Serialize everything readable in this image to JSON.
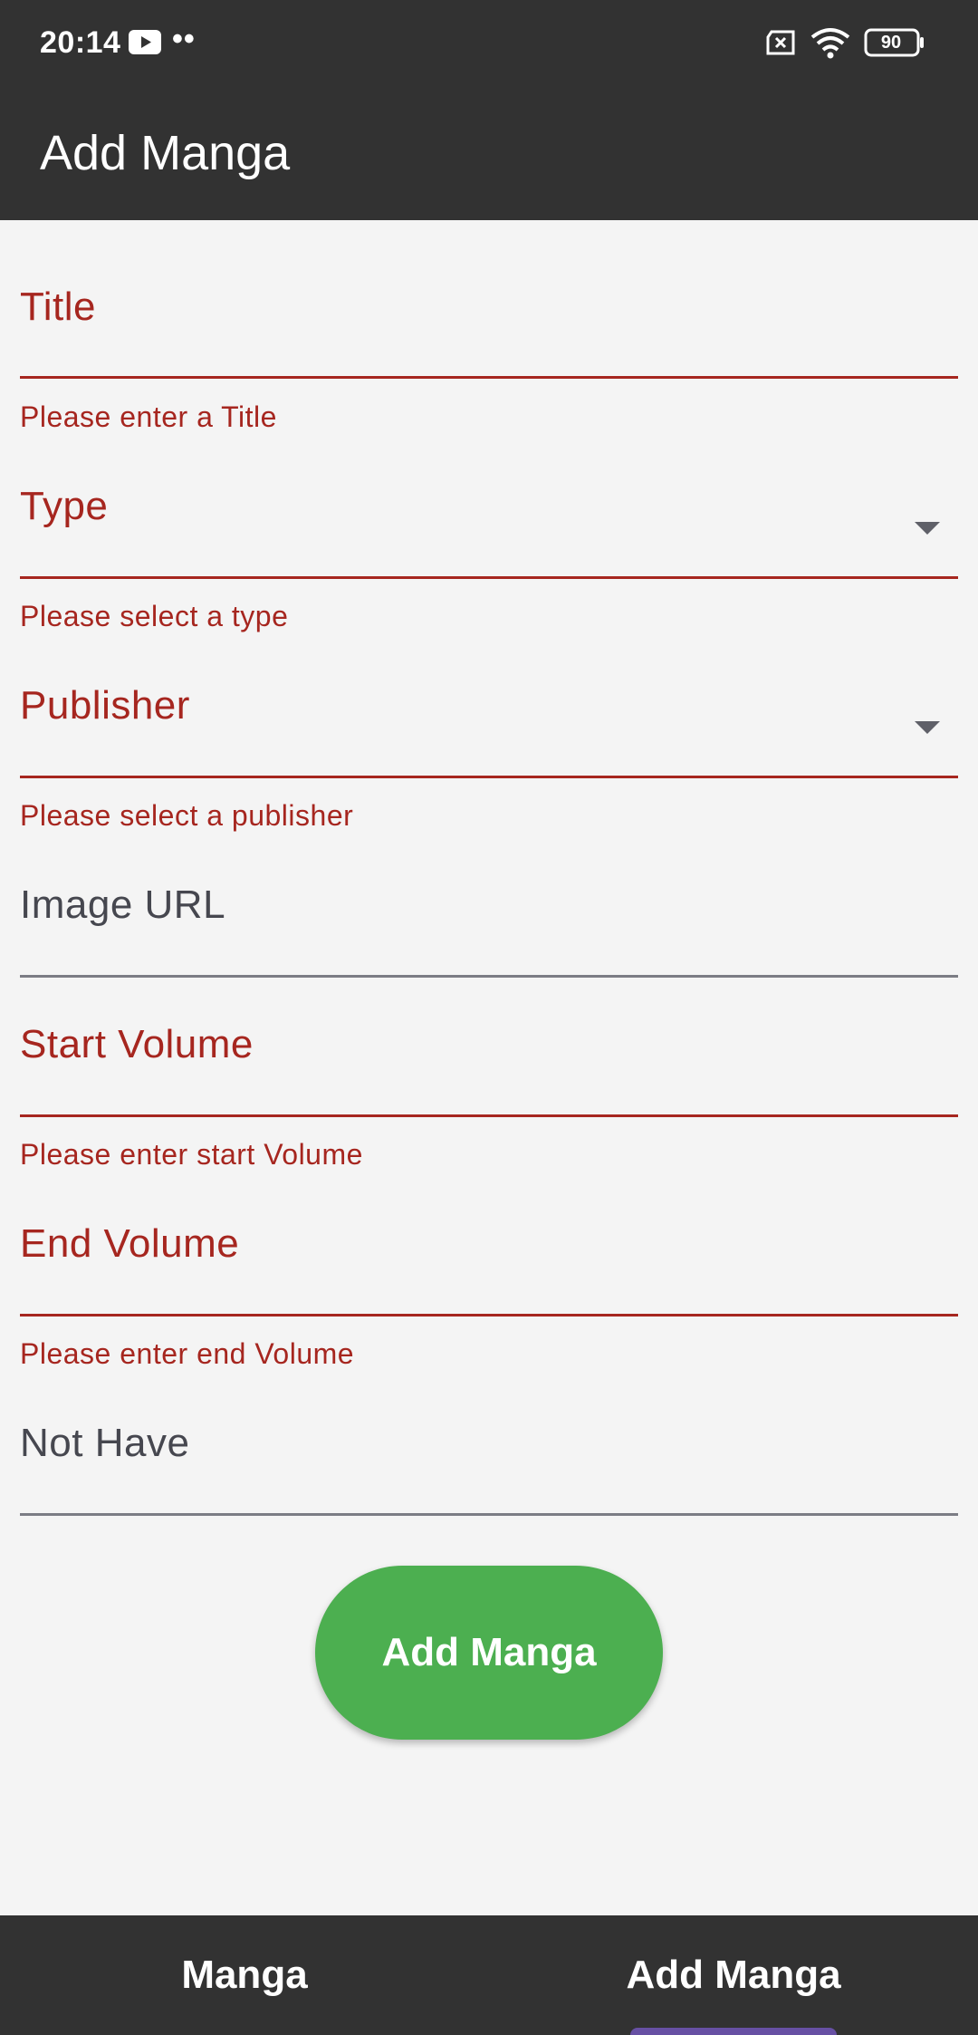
{
  "status_bar": {
    "time": "20:14",
    "dots": "••",
    "battery": "90",
    "icons": [
      "youtube-icon",
      "no-sim-icon",
      "wifi-icon",
      "battery-icon"
    ]
  },
  "app_bar": {
    "title": "Add Manga"
  },
  "form": {
    "title": {
      "label": "Title",
      "helper": "Please enter a Title"
    },
    "type": {
      "label": "Type",
      "helper": "Please select a type"
    },
    "publisher": {
      "label": "Publisher",
      "helper": "Please select a publisher"
    },
    "image_url": {
      "label": "Image URL"
    },
    "start_volume": {
      "label": "Start Volume",
      "helper": "Please enter start Volume"
    },
    "end_volume": {
      "label": "End Volume",
      "helper": "Please enter end Volume"
    },
    "not_have": {
      "label": "Not Have"
    },
    "submit_label": "Add Manga"
  },
  "bottom_nav": {
    "items": [
      {
        "label": "Manga"
      },
      {
        "label": "Add Manga"
      }
    ],
    "selected": "Add Manga"
  },
  "colors": {
    "error": "#a6261f",
    "button": "#4caf50",
    "bar": "#323232",
    "indicator": "#6750a4"
  }
}
